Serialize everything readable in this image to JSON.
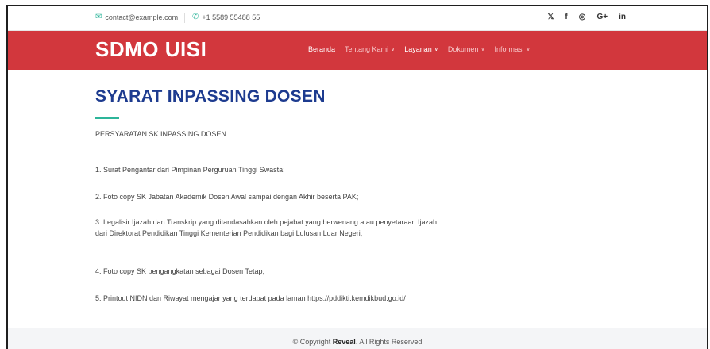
{
  "topbar": {
    "email": "contact@example.com",
    "phone": "+1 5589 55488 55",
    "email_icon": "envelope-icon",
    "phone_icon": "phone-icon",
    "social": [
      "𝕏",
      "f",
      "◎",
      "G+",
      "in"
    ]
  },
  "header": {
    "logo": "SDMO UISI",
    "background": "#d2373d",
    "nav": [
      {
        "label": "Beranda",
        "dropdown": false
      },
      {
        "label": "Tentang Kami",
        "dropdown": true
      },
      {
        "label": "Layanan",
        "dropdown": true
      },
      {
        "label": "Dokumen",
        "dropdown": true
      },
      {
        "label": "Informasi",
        "dropdown": true
      }
    ]
  },
  "main": {
    "title": "SYARAT INPASSING DOSEN",
    "subtitle": "PERSYARATAN SK INPASSING DOSEN",
    "items": [
      "1. Surat Pengantar dari Pimpinan Perguruan Tinggi Swasta;",
      "2. Foto copy SK Jabatan Akademik Dosen Awal sampai dengan Akhir beserta PAK;",
      "3. Legalisir Ijazah dan Transkrip yang ditandasahkan oleh pejabat yang berwenang atau penyetaraan Ijazah dari Direktorat Pendidikan Tinggi Kementerian Pendidikan bagi Lulusan Luar Negeri;",
      "4. Foto copy SK pengangkatan sebagai Dosen Tetap;",
      "5. Printout NIDN dan Riwayat mengajar yang terdapat pada laman https://pddikti.kemdikbud.go.id/"
    ]
  },
  "footer": {
    "prefix": "© Copyright ",
    "brand": "Reveal",
    "suffix": ". All Rights Reserved"
  }
}
